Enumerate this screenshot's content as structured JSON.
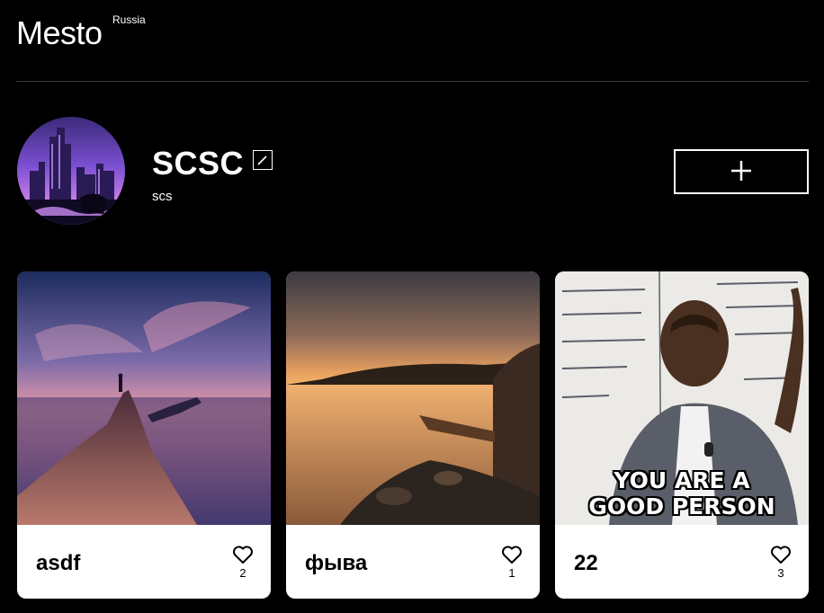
{
  "header": {
    "logo_text": "Mesto",
    "logo_sup": "Russia"
  },
  "profile": {
    "name": "SCSC",
    "about": "scs",
    "edit_icon": "pencil-icon",
    "add_icon": "plus-icon"
  },
  "cards": [
    {
      "title": "asdf",
      "likes": "2",
      "image": "mountain-peak-sunset"
    },
    {
      "title": "фыва",
      "likes": "1",
      "image": "lake-sunset-boat"
    },
    {
      "title": "22",
      "likes": "3",
      "image": "meme-man-whiteboard",
      "caption_line1": "YOU ARE A",
      "caption_line2": "GOOD PERSON"
    }
  ],
  "colors": {
    "background": "#000000",
    "card_background": "#ffffff",
    "divider": "#545454"
  }
}
